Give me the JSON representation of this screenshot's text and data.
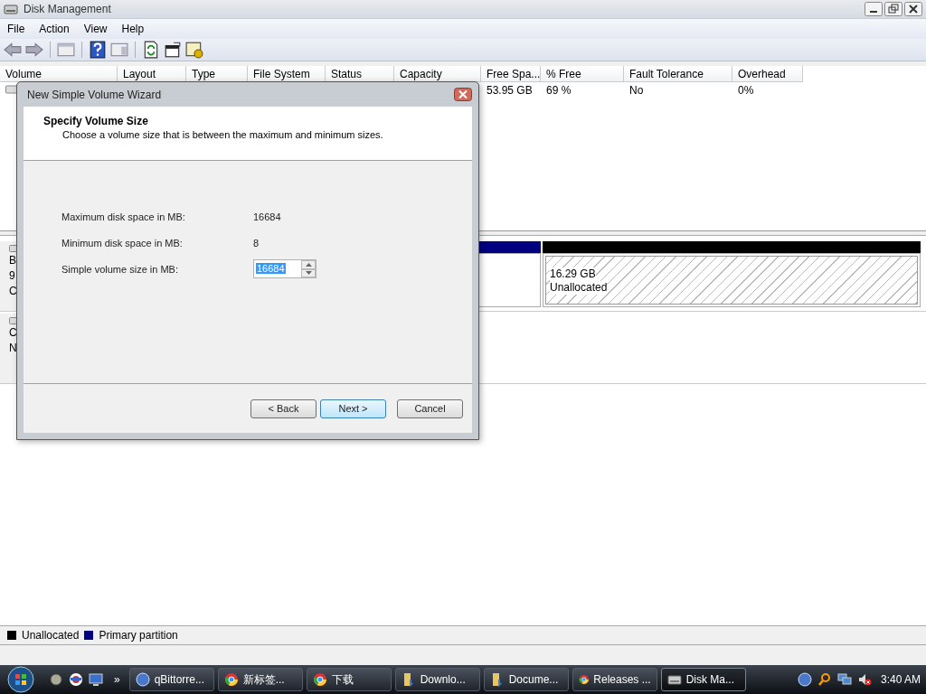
{
  "window": {
    "title": "Disk Management"
  },
  "menu": [
    "File",
    "Action",
    "View",
    "Help"
  ],
  "volume_table": {
    "columns": [
      "Volume",
      "Layout",
      "Type",
      "File System",
      "Status",
      "Capacity",
      "Free Spa...",
      "% Free",
      "Fault Tolerance",
      "Overhead"
    ],
    "rows": [
      {
        "free_space": "53.95 GB",
        "percent_free": "69 %",
        "fault_tolerance": "No",
        "overhead": "0%"
      }
    ]
  },
  "disks": [
    {
      "label_fragments": [
        "B",
        "9",
        "C"
      ],
      "partitions": [
        {
          "kind": "primary"
        },
        {
          "kind": "unallocated",
          "size": "16.29 GB",
          "status": "Unallocated"
        }
      ]
    },
    {
      "label_fragments": [
        "C",
        "N"
      ]
    }
  ],
  "legend": [
    {
      "label": "Unallocated",
      "color": "#000000"
    },
    {
      "label": "Primary partition",
      "color": "#000080"
    }
  ],
  "dialog": {
    "title": "New Simple Volume Wizard",
    "heading": "Specify Volume Size",
    "subtitle": "Choose a volume size that is between the maximum and minimum sizes.",
    "fields": [
      {
        "label": "Maximum disk space in MB:",
        "value": "16684"
      },
      {
        "label": "Minimum disk space in MB:",
        "value": "8"
      }
    ],
    "size_input": {
      "label": "Simple volume size in MB:",
      "value": "16684",
      "text_selected": true
    },
    "buttons": [
      {
        "label": "< Back",
        "hovered": false
      },
      {
        "label": "Next >",
        "hovered": true
      },
      {
        "label": "Cancel",
        "hovered": false
      }
    ]
  },
  "taskbar": {
    "overflow": "»",
    "tasks": [
      {
        "label": "qBittorre...",
        "kind": "qb",
        "active": false
      },
      {
        "label": "新标签...",
        "kind": "chrome",
        "active": false
      },
      {
        "label": "下载",
        "kind": "chrome",
        "active": false
      },
      {
        "label": "Downlo...",
        "kind": "folder",
        "active": false
      },
      {
        "label": "Docume...",
        "kind": "folder",
        "active": false
      },
      {
        "label": "Releases ...",
        "kind": "chrome",
        "active": false
      },
      {
        "label": "Disk Ma...",
        "kind": "disk",
        "active": true
      }
    ],
    "clock": "3:40 AM"
  }
}
